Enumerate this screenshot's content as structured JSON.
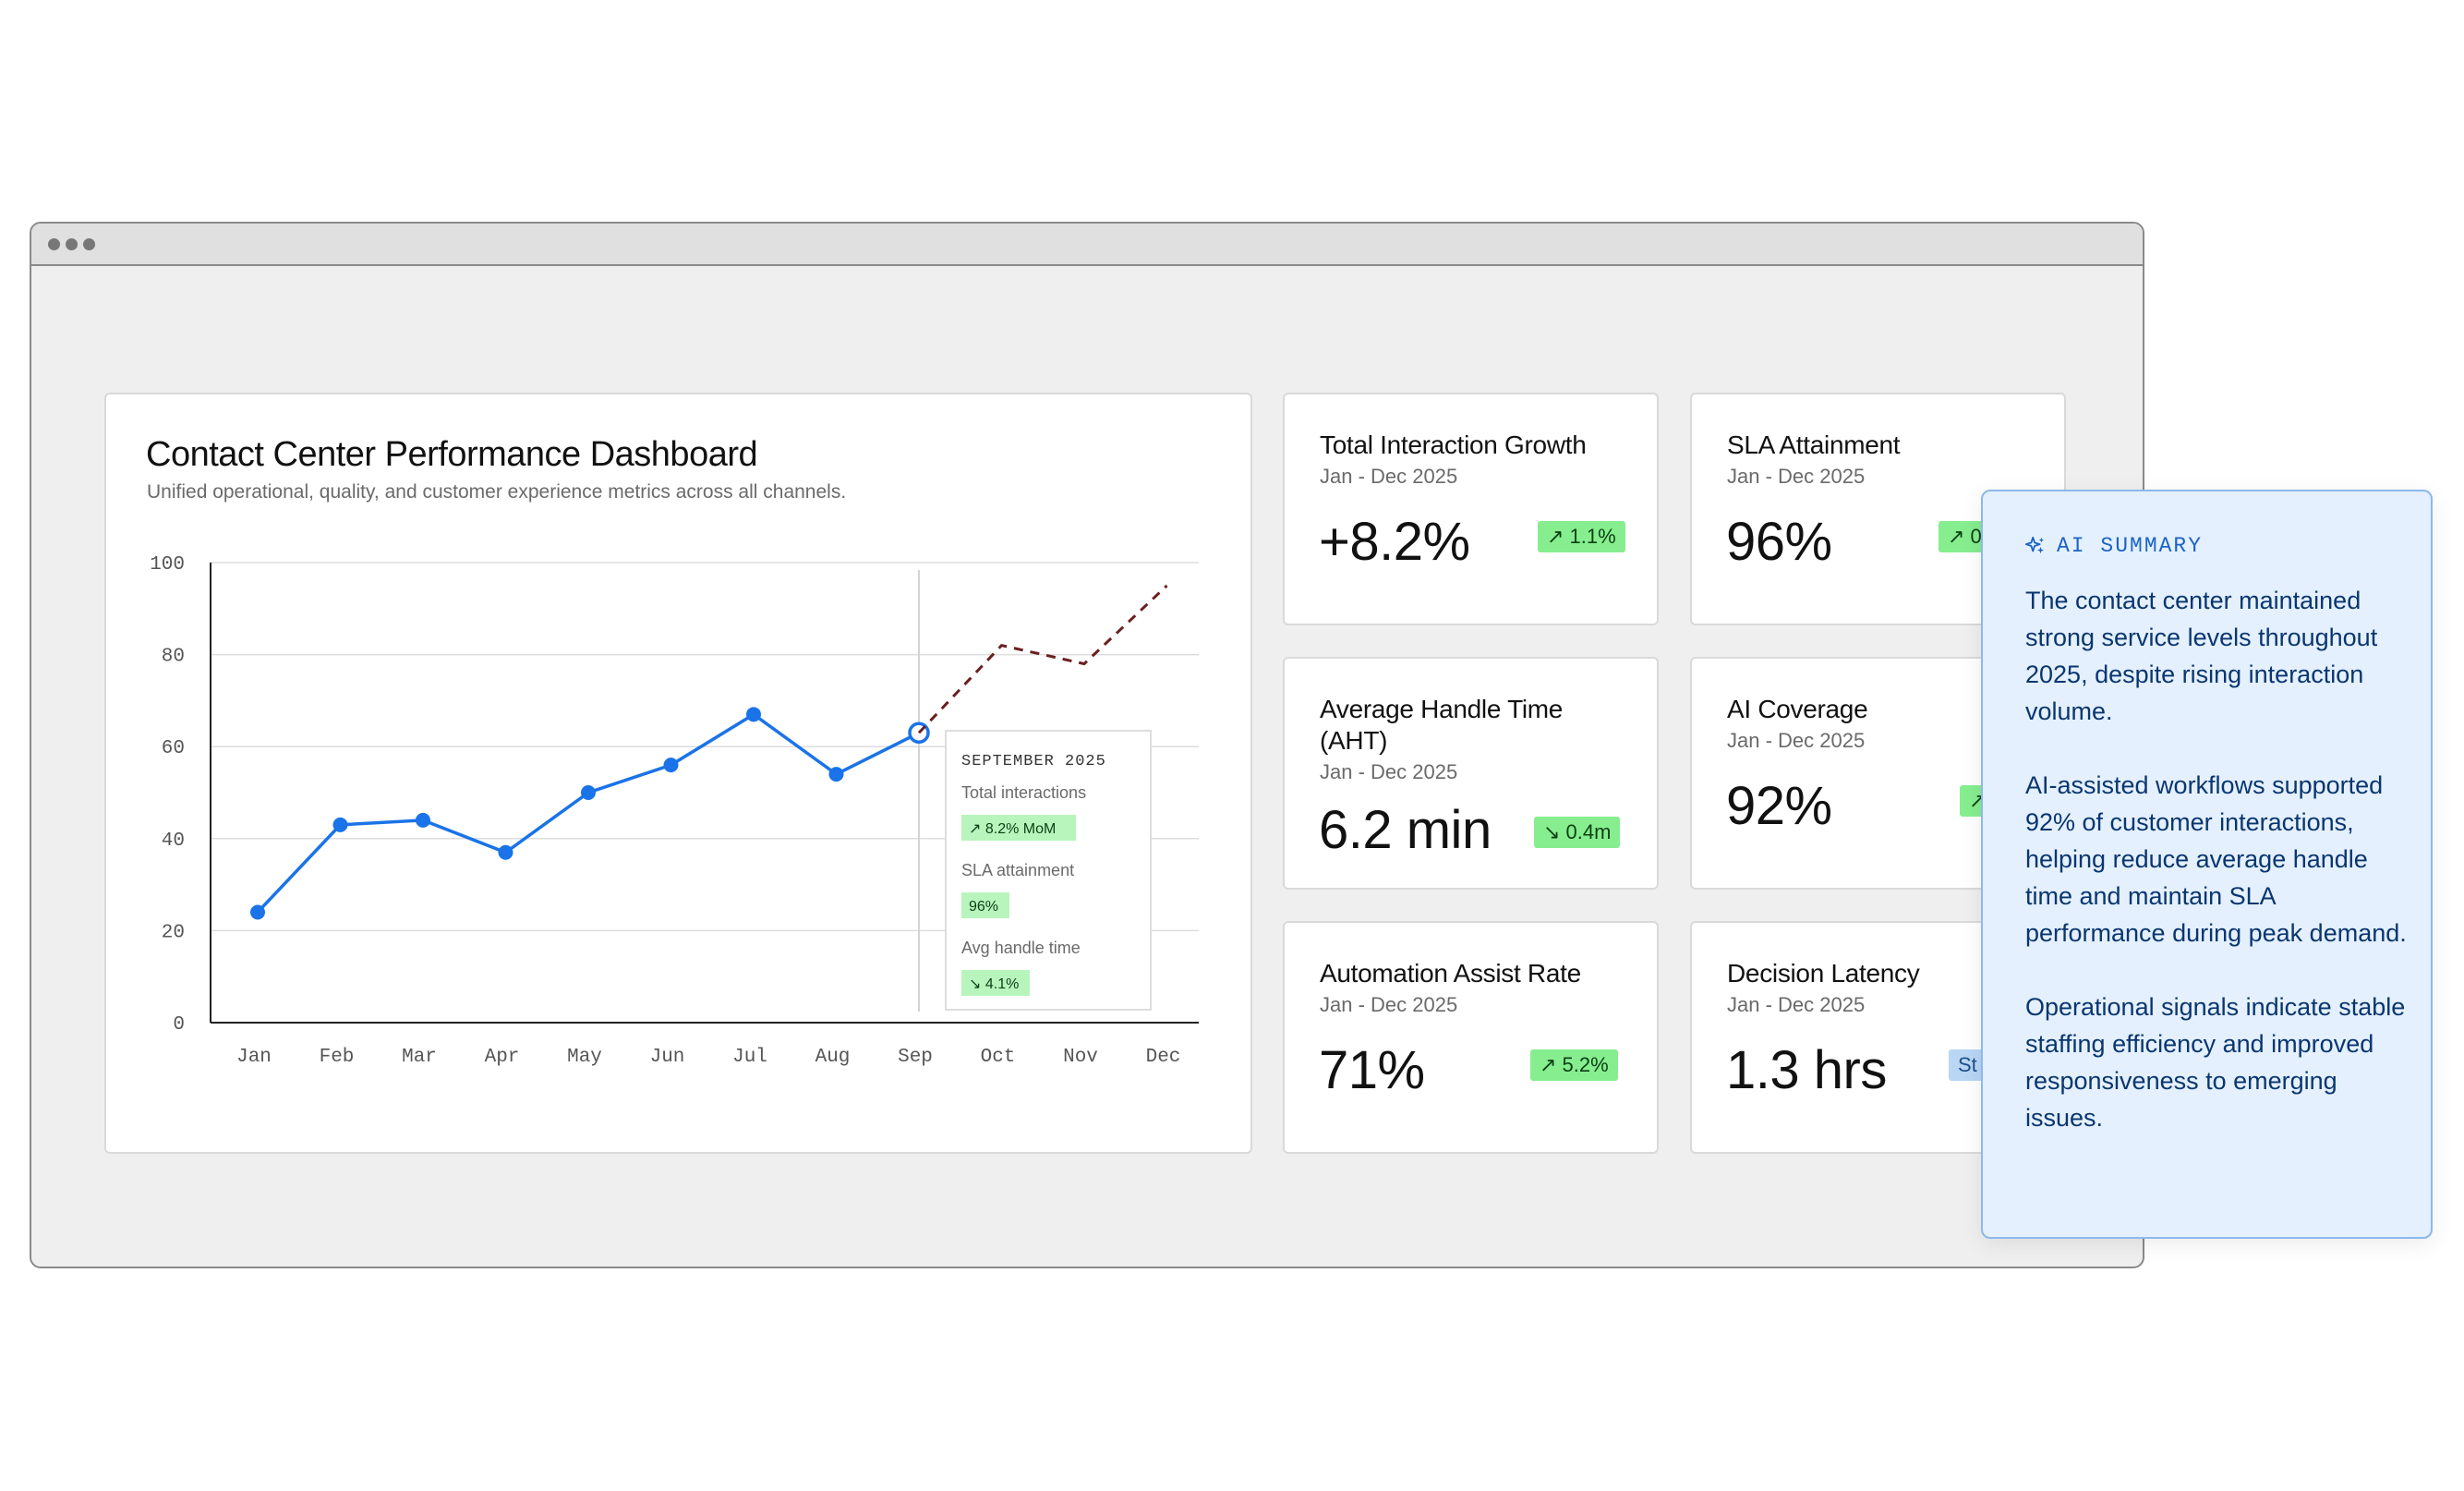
{
  "dashboard": {
    "title": "Contact Center Performance Dashboard",
    "subtitle": "Unified operational, quality, and customer experience metrics across all channels."
  },
  "chart_data": {
    "type": "line",
    "x": [
      "Jan",
      "Feb",
      "Mar",
      "Apr",
      "May",
      "Jun",
      "Jul",
      "Aug",
      "Sep",
      "Oct",
      "Nov",
      "Dec"
    ],
    "series": [
      {
        "values": [
          24,
          43,
          44,
          37,
          50,
          56,
          67,
          54,
          63,
          null,
          null,
          null
        ],
        "style": "solid"
      },
      {
        "values": [
          null,
          null,
          null,
          null,
          null,
          null,
          null,
          null,
          63,
          82,
          78,
          95
        ],
        "style": "dashed"
      }
    ],
    "ylim": [
      0,
      100
    ],
    "yticks": [
      "0",
      "20",
      "40",
      "60",
      "80",
      "100"
    ],
    "grid": true,
    "colors": {
      "actual": "#1a73e8",
      "forecast": "#6b1f1f",
      "grid": "#dddddd"
    },
    "highlight_index": 8
  },
  "tooltip": {
    "title": "SEPTEMBER 2025",
    "rows": [
      {
        "label": "Total interactions",
        "badge": "↗ 8.2% MoM"
      },
      {
        "label": "SLA attainment",
        "badge": "96%"
      },
      {
        "label": "Avg handle time",
        "badge": "↘ 4.1%"
      }
    ]
  },
  "metrics": [
    {
      "title": "Total Interaction Growth",
      "period": "Jan - Dec 2025",
      "value": "+8.2%",
      "badge": "↗ 1.1%"
    },
    {
      "title": "SLA Attainment",
      "period": "Jan - Dec 2025",
      "value": "96%",
      "badge": "↗ 0"
    },
    {
      "title": "Average Handle Time (AHT)",
      "period": "Jan - Dec 2025",
      "value": "6.2 min",
      "badge": "↘ 0.4m"
    },
    {
      "title": "AI Coverage",
      "period": "Jan - Dec 2025",
      "value": "92%",
      "badge": "↗"
    },
    {
      "title": "Automation Assist Rate",
      "period": "Jan - Dec 2025",
      "value": "71%",
      "badge": "↗ 5.2%"
    },
    {
      "title": "Decision Latency",
      "period": "Jan - Dec 2025",
      "value": "1.3 hrs",
      "badge": "St"
    }
  ],
  "ai_summary": {
    "heading": "AI SUMMARY",
    "icon": "sparkle-icon",
    "paragraphs": [
      "The contact center maintained strong service levels throughout 2025, despite rising interaction volume.",
      "AI-assisted workflows supported 92% of customer interactions, helping reduce average handle time and maintain SLA performance during peak demand.",
      "Operational signals indicate stable staffing efficiency and improved responsiveness to emerging issues."
    ]
  }
}
